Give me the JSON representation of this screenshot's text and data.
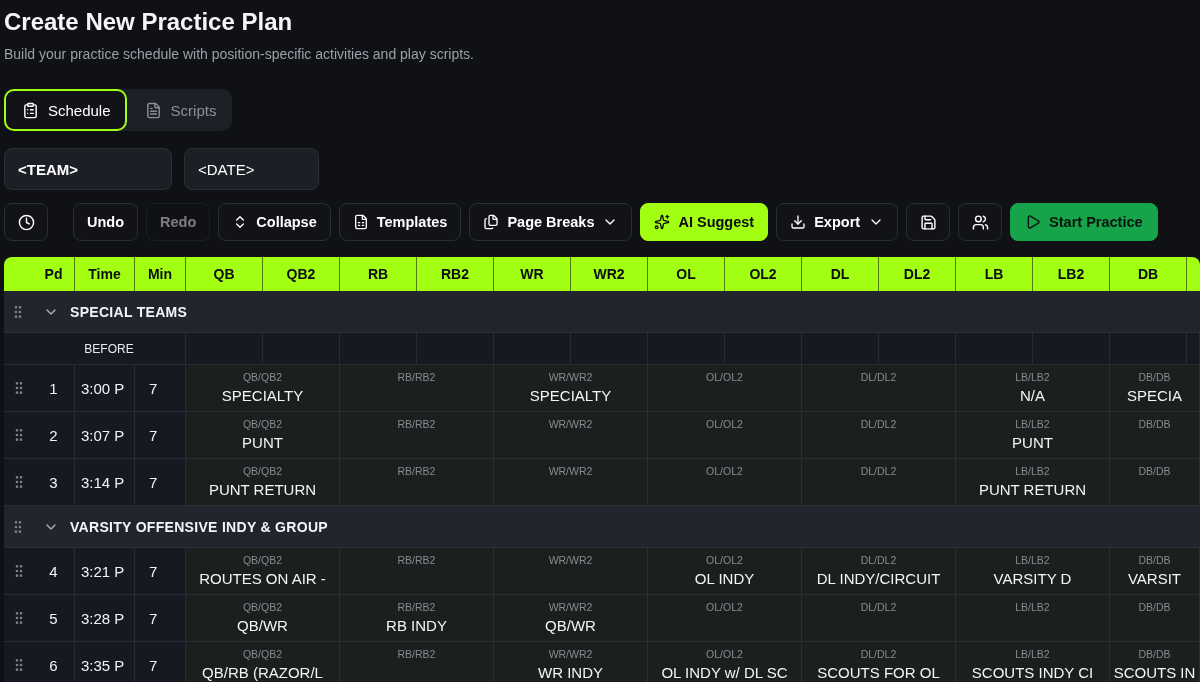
{
  "title": "Create New Practice Plan",
  "subtitle": "Build your practice schedule with position-specific activities and play scripts.",
  "tabs": [
    {
      "label": "Schedule",
      "selected": true
    },
    {
      "label": "Scripts",
      "selected": false
    }
  ],
  "team_field": {
    "value": "<TEAM>"
  },
  "date_field": {
    "value": "<DATE>"
  },
  "toolbar": [
    {
      "kind": "icon",
      "disabled": false,
      "dropdown": false
    },
    {
      "kind": "plain",
      "label": "Undo",
      "disabled": false,
      "dropdown": false
    },
    {
      "kind": "plain",
      "label": "Redo",
      "disabled": true,
      "dropdown": false
    },
    {
      "kind": "plain",
      "label": "Collapse",
      "disabled": false,
      "dropdown": false
    },
    {
      "kind": "plain",
      "label": "Templates",
      "disabled": false,
      "dropdown": false
    },
    {
      "kind": "plain",
      "label": "Page Breaks",
      "disabled": false,
      "dropdown": true
    },
    {
      "kind": "accent",
      "label": "AI Suggest",
      "disabled": false,
      "dropdown": false
    },
    {
      "kind": "plain",
      "label": "Export",
      "disabled": false,
      "dropdown": true
    },
    {
      "kind": "icon",
      "disabled": false,
      "dropdown": false
    },
    {
      "kind": "icon",
      "disabled": false,
      "dropdown": false
    },
    {
      "kind": "go",
      "label": "Start Practice",
      "disabled": false,
      "dropdown": false
    }
  ],
  "table": {
    "columns": [
      "Pd",
      "Time",
      "Min",
      "QB",
      "QB2",
      "RB",
      "RB2",
      "WR",
      "WR2",
      "OL",
      "OL2",
      "DL",
      "DL2",
      "LB",
      "LB2",
      "DB"
    ],
    "sections": [
      {
        "title": "SPECIAL TEAMS",
        "expanded": true,
        "before_label": "BEFORE",
        "rows": [
          {
            "pd": "1",
            "time": "3:00 P",
            "min": "7",
            "cells": [
              {
                "label": "QB/QB2",
                "value": "SPECIALTY"
              },
              {
                "label": "RB/RB2"
              },
              {
                "label": "WR/WR2",
                "value": "SPECIALTY"
              },
              {
                "label": "OL/OL2"
              },
              {
                "label": "DL/DL2"
              },
              {
                "label": "LB/LB2",
                "value": "N/A"
              },
              {
                "label": "DB/DB",
                "value": "SPECIA"
              }
            ]
          },
          {
            "pd": "2",
            "time": "3:07 P",
            "min": "7",
            "cells": [
              {
                "label": "QB/QB2",
                "value": "PUNT"
              },
              {
                "label": "RB/RB2"
              },
              {
                "label": "WR/WR2"
              },
              {
                "label": "OL/OL2"
              },
              {
                "label": "DL/DL2"
              },
              {
                "label": "LB/LB2",
                "value": "PUNT"
              },
              {
                "label": "DB/DB"
              }
            ]
          },
          {
            "pd": "3",
            "time": "3:14 P",
            "min": "7",
            "cells": [
              {
                "label": "QB/QB2",
                "value": "PUNT RETURN"
              },
              {
                "label": "RB/RB2"
              },
              {
                "label": "WR/WR2"
              },
              {
                "label": "OL/OL2"
              },
              {
                "label": "DL/DL2"
              },
              {
                "label": "LB/LB2",
                "value": "PUNT RETURN"
              },
              {
                "label": "DB/DB"
              }
            ]
          }
        ]
      },
      {
        "title": "VARSITY OFFENSIVE INDY & GROUP",
        "expanded": true,
        "rows": [
          {
            "pd": "4",
            "time": "3:21 P",
            "min": "7",
            "cells": [
              {
                "label": "QB/QB2",
                "value": "ROUTES ON AIR -"
              },
              {
                "label": "RB/RB2"
              },
              {
                "label": "WR/WR2"
              },
              {
                "label": "OL/OL2",
                "value": "OL INDY"
              },
              {
                "label": "DL/DL2",
                "value": "DL INDY/CIRCUIT"
              },
              {
                "label": "LB/LB2",
                "value": "VARSITY D"
              },
              {
                "label": "DB/DB",
                "value": "VARSIT"
              }
            ]
          },
          {
            "pd": "5",
            "time": "3:28 P",
            "min": "7",
            "cells": [
              {
                "label": "QB/QB2",
                "value": "QB/WR"
              },
              {
                "label": "RB/RB2",
                "value": "RB INDY"
              },
              {
                "label": "WR/WR2",
                "value": "QB/WR"
              },
              {
                "label": "OL/OL2"
              },
              {
                "label": "DL/DL2"
              },
              {
                "label": "LB/LB2"
              },
              {
                "label": "DB/DB"
              }
            ]
          },
          {
            "pd": "6",
            "time": "3:35 P",
            "min": "7",
            "cells": [
              {
                "label": "QB/QB2",
                "value": "QB/RB (RAZOR/L"
              },
              {
                "label": "RB/RB2"
              },
              {
                "label": "WR/WR2",
                "value": "WR INDY"
              },
              {
                "label": "OL/OL2",
                "value": "OL INDY w/ DL SC"
              },
              {
                "label": "DL/DL2",
                "value": "SCOUTS FOR OL"
              },
              {
                "label": "LB/LB2",
                "value": "SCOUTS INDY CI"
              },
              {
                "label": "DB/DB",
                "value": "SCOUTS IN"
              }
            ]
          }
        ]
      }
    ]
  }
}
